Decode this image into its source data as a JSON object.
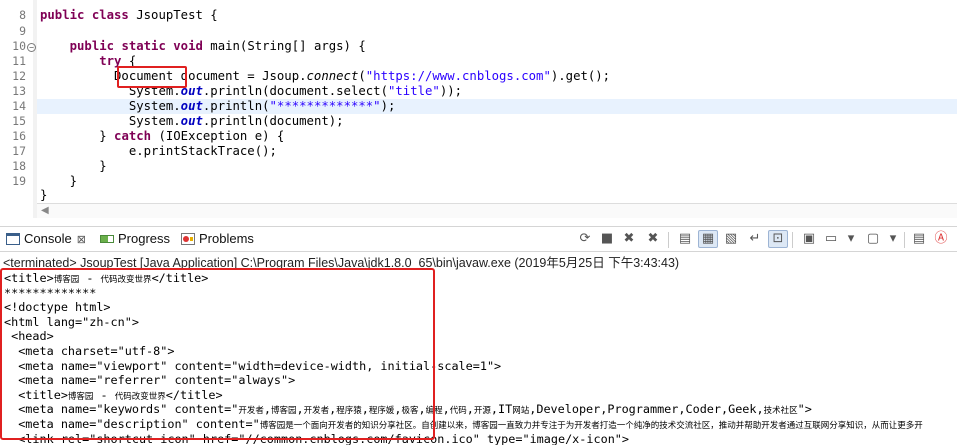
{
  "editor": {
    "lines": [
      {
        "num": "8",
        "parts": [
          [
            "kw",
            "public class "
          ],
          [
            "",
            "JsoupTest {"
          ]
        ]
      },
      {
        "num": "9",
        "parts": []
      },
      {
        "num": "10",
        "fold": true,
        "parts": [
          [
            "",
            "    "
          ],
          [
            "kw",
            "public static void "
          ],
          [
            "",
            "main(String[] args) {"
          ]
        ]
      },
      {
        "num": "11",
        "parts": [
          [
            "",
            "        "
          ],
          [
            "kw",
            "try "
          ],
          [
            "",
            "{"
          ]
        ]
      },
      {
        "num": "12",
        "parts": [
          [
            "",
            "          Document document = Jsoup."
          ],
          [
            "itl",
            "connect"
          ],
          [
            "",
            "("
          ],
          [
            "str",
            "\"https://www.cnblogs.com\""
          ],
          [
            "",
            ").get();"
          ]
        ]
      },
      {
        "num": "13",
        "parts": [
          [
            "",
            "            System."
          ],
          [
            "fld",
            "out"
          ],
          [
            "",
            ".println(document.select("
          ],
          [
            "str",
            "\"title\""
          ],
          [
            "",
            "));"
          ]
        ]
      },
      {
        "num": "14",
        "highlight": true,
        "parts": [
          [
            "",
            "            System."
          ],
          [
            "fld",
            "out"
          ],
          [
            "",
            ".println("
          ],
          [
            "str",
            "\"*************\""
          ],
          [
            "",
            ");"
          ]
        ]
      },
      {
        "num": "15",
        "parts": [
          [
            "",
            "            System."
          ],
          [
            "fld",
            "out"
          ],
          [
            "",
            ".println(document);"
          ]
        ]
      },
      {
        "num": "16",
        "parts": [
          [
            "",
            "        } "
          ],
          [
            "kw",
            "catch "
          ],
          [
            "",
            "(IOException e) {"
          ]
        ]
      },
      {
        "num": "17",
        "parts": [
          [
            "",
            "            e.printStackTrace();"
          ]
        ]
      },
      {
        "num": "18",
        "parts": [
          [
            "",
            "        }"
          ]
        ]
      },
      {
        "num": "19",
        "parts": [
          [
            "",
            "    }"
          ]
        ]
      },
      {
        "num": "",
        "parts": [
          [
            "",
            "}"
          ]
        ]
      }
    ],
    "boxed_word": "Document"
  },
  "console": {
    "tabs": [
      {
        "label": "Console",
        "icon": "console-icon"
      },
      {
        "label": "Progress",
        "icon": "progress-icon"
      },
      {
        "label": "Problems",
        "icon": "problems-icon"
      }
    ],
    "status": "<terminated> JsoupTest [Java Application] C:\\Program Files\\Java\\jdk1.8.0_65\\bin\\javaw.exe (2019年5月25日 下午3:43:43)",
    "output": [
      "<title>博客园 - 代码改变世界</title>",
      "*************",
      "<!doctype html>",
      "<html lang=\"zh-cn\">",
      " <head>",
      "  <meta charset=\"utf-8\">",
      "  <meta name=\"viewport\" content=\"width=device-width, initial-scale=1\">",
      "  <meta name=\"referrer\" content=\"always\">",
      "  <title>博客园 - 代码改变世界</title>",
      "  <meta name=\"keywords\" content=\"开发者,博客园,开发者,程序猿,程序媛,极客,编程,代码,开源,IT网站,Developer,Programmer,Coder,Geek,技术社区\">",
      "  <meta name=\"description\" content=\"博客园是一个面向开发者的知识分享社区。自创建以来，博客园一直致力并专注于为开发者打造一个纯净的技术交流社区，推动并帮助开发者通过互联网分享知识，从而让更多开",
      "  <link rel=\"shortcut icon\" href=\"//common.cnblogs.com/favicon.ico\" type=\"image/x-icon\">"
    ]
  },
  "toolbar_icons": [
    "remove-launch-icon",
    "terminate-icon",
    "remove-all-icon",
    "remove-all-terminated-icon",
    "scroll-lock-icon",
    "show-on-stdout-icon",
    "show-on-stderr-icon",
    "word-wrap-icon",
    "pin-console-icon",
    "display-console-icon",
    "new-console-icon",
    "open-console-icon",
    "minimize-icon",
    "maximize-icon"
  ],
  "colors": {
    "keyword": "#7f0055",
    "string": "#2a00ff",
    "field": "#0000c0",
    "highlight_box": "#e02020"
  }
}
